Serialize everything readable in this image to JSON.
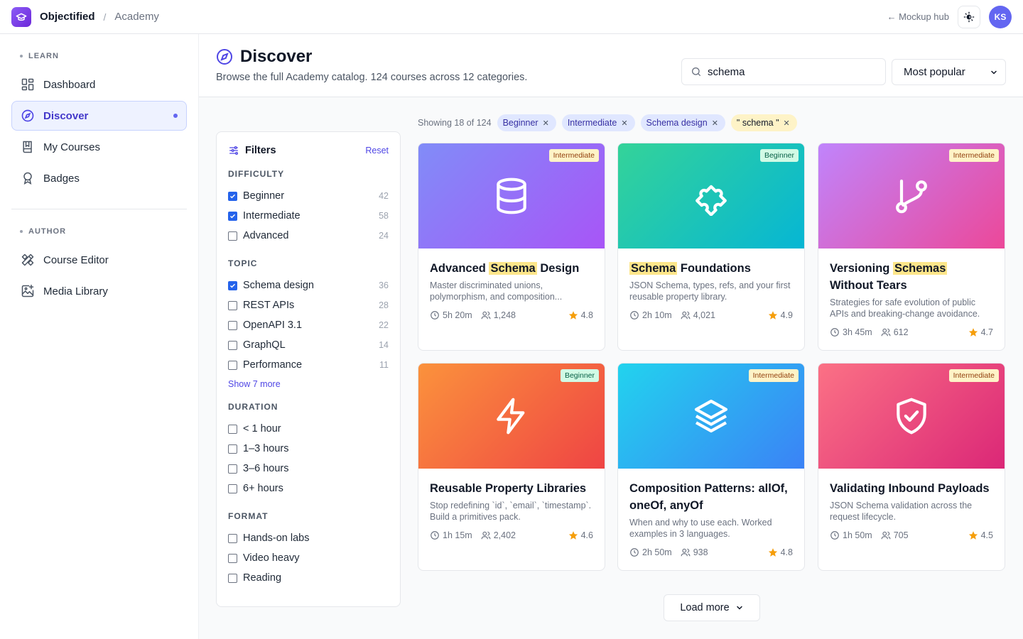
{
  "topbar": {
    "brand": "Objectified",
    "separator": "/",
    "section": "Academy",
    "back_link": "← Mockup hub",
    "avatar_initials": "KS"
  },
  "sidebar": {
    "learn_label": "LEARN",
    "learn_items": [
      {
        "label": "Dashboard",
        "icon": "dashboard-icon"
      },
      {
        "label": "Discover",
        "icon": "compass-icon",
        "active": true
      },
      {
        "label": "My Courses",
        "icon": "book-icon"
      },
      {
        "label": "Badges",
        "icon": "badge-icon"
      }
    ],
    "author_label": "AUTHOR",
    "author_items": [
      {
        "label": "Course Editor",
        "icon": "pencil-ruler-icon"
      },
      {
        "label": "Media Library",
        "icon": "image-plus-icon"
      }
    ]
  },
  "header": {
    "title": "Discover",
    "subtitle": "Browse the full Academy catalog. 124 courses across 12 categories.",
    "search_value": "schema",
    "sort_value": "Most popular"
  },
  "filters": {
    "title": "Filters",
    "reset": "Reset",
    "difficulty_label": "DIFFICULTY",
    "difficulty": [
      {
        "label": "Beginner",
        "count": "42",
        "checked": true
      },
      {
        "label": "Intermediate",
        "count": "58",
        "checked": true
      },
      {
        "label": "Advanced",
        "count": "24",
        "checked": false
      }
    ],
    "topic_label": "TOPIC",
    "topic": [
      {
        "label": "Schema design",
        "count": "36",
        "checked": true
      },
      {
        "label": "REST APIs",
        "count": "28",
        "checked": false
      },
      {
        "label": "OpenAPI 3.1",
        "count": "22",
        "checked": false
      },
      {
        "label": "GraphQL",
        "count": "14",
        "checked": false
      },
      {
        "label": "Performance",
        "count": "11",
        "checked": false
      }
    ],
    "show_more": "Show 7 more",
    "duration_label": "DURATION",
    "duration": [
      {
        "label": "< 1 hour",
        "checked": false
      },
      {
        "label": "1–3 hours",
        "checked": false
      },
      {
        "label": "3–6 hours",
        "checked": false
      },
      {
        "label": "6+ hours",
        "checked": false
      }
    ],
    "format_label": "FORMAT",
    "format": [
      {
        "label": "Hands-on labs",
        "checked": false
      },
      {
        "label": "Video heavy",
        "checked": false
      },
      {
        "label": "Reading",
        "checked": false
      }
    ]
  },
  "results": {
    "showing": "Showing 18 of 124",
    "chips": [
      "Beginner",
      "Intermediate",
      "Schema design"
    ],
    "query_chip": "\" schema \"",
    "load_more": "Load more"
  },
  "courses": [
    {
      "title_pre": "Advanced ",
      "title_hl": "Schema",
      "title_post": " Design",
      "level": "Intermediate",
      "desc": "Master discriminated unions, polymorphism, and composition...",
      "duration": "5h 20m",
      "learners": "1,248",
      "rating": "4.8",
      "icon": "database-icon",
      "gradient": [
        "#818cf8",
        "#a855f7"
      ]
    },
    {
      "title_pre": "",
      "title_hl": "Schema",
      "title_post": " Foundations",
      "level": "Beginner",
      "desc": "JSON Schema, types, refs, and your first reusable property library.",
      "duration": "2h 10m",
      "learners": "4,021",
      "rating": "4.9",
      "icon": "puzzle-icon",
      "gradient": [
        "#34d399",
        "#06b6d4"
      ]
    },
    {
      "title_pre": "Versioning ",
      "title_hl": "Schemas",
      "title_post": " Without Tears",
      "level": "Intermediate",
      "desc": "Strategies for safe evolution of public APIs and breaking-change avoidance.",
      "duration": "3h 45m",
      "learners": "612",
      "rating": "4.7",
      "icon": "git-branch-icon",
      "gradient": [
        "#c084fc",
        "#ec4899"
      ]
    },
    {
      "title_pre": "Reusable Property Libraries",
      "title_hl": "",
      "title_post": "",
      "level": "Beginner",
      "desc": "Stop redefining `id`, `email`, `timestamp`. Build a primitives pack.",
      "duration": "1h 15m",
      "learners": "2,402",
      "rating": "4.6",
      "icon": "lightning-icon",
      "gradient": [
        "#fb923c",
        "#ef4444"
      ]
    },
    {
      "title_pre": "Composition Patterns: allOf, oneOf, anyOf",
      "title_hl": "",
      "title_post": "",
      "level": "Intermediate",
      "desc": "When and why to use each. Worked examples in 3 languages.",
      "duration": "2h 50m",
      "learners": "938",
      "rating": "4.8",
      "icon": "layers-icon",
      "gradient": [
        "#22d3ee",
        "#3b82f6"
      ]
    },
    {
      "title_pre": "Validating Inbound Payloads",
      "title_hl": "",
      "title_post": "",
      "level": "Intermediate",
      "desc": "JSON Schema validation across the request lifecycle.",
      "duration": "1h 50m",
      "learners": "705",
      "rating": "4.5",
      "icon": "shield-check-icon",
      "gradient": [
        "#fb7185",
        "#db2777"
      ]
    }
  ]
}
